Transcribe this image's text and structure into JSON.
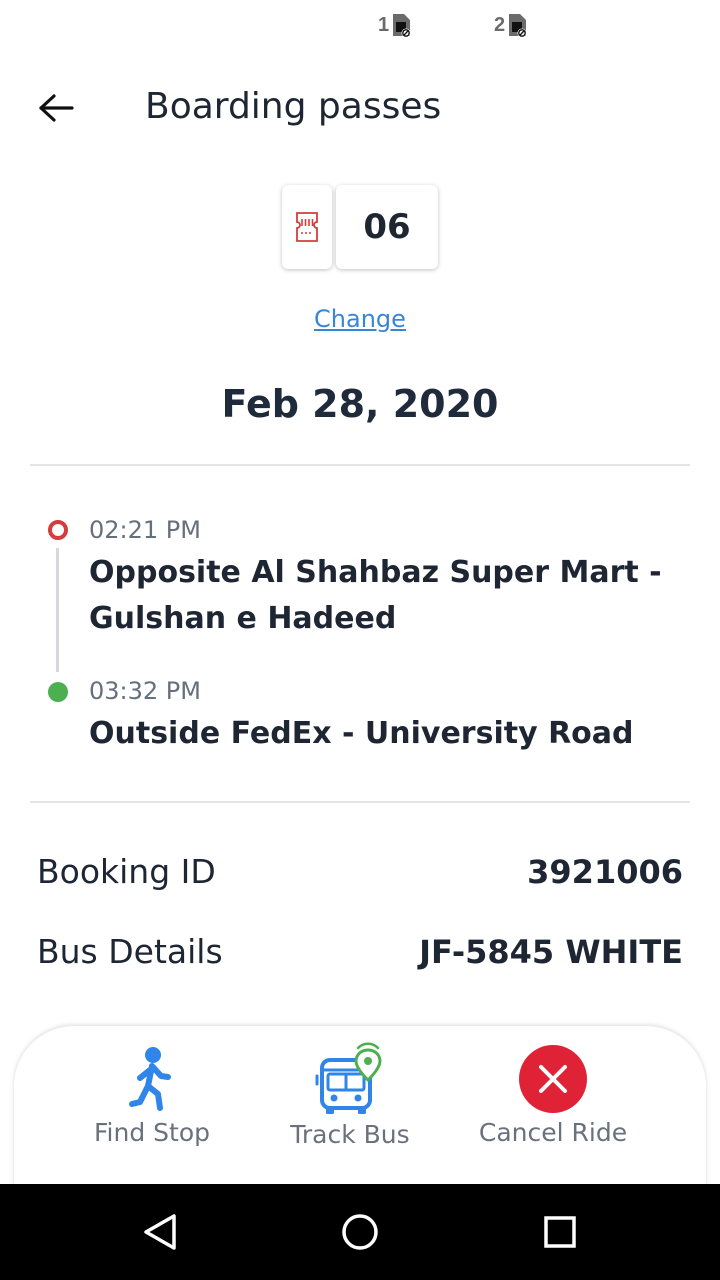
{
  "status_bar": {
    "sim1": "1",
    "sim2": "2"
  },
  "header": {
    "title": "Boarding passes",
    "back_icon": "arrow-left-icon"
  },
  "pass_selector": {
    "icon": "ticket-icon",
    "count": "06",
    "change_label": "Change"
  },
  "trip": {
    "date": "Feb 28, 2020",
    "origin": {
      "time": "02:21 PM",
      "name": "Opposite Al Shahbaz Super Mart - Gulshan e Hadeed"
    },
    "destination": {
      "time": "03:32 PM",
      "name": "Outside FedEx - University Road"
    }
  },
  "booking": {
    "id_label": "Booking ID",
    "id_value": "3921006",
    "bus_label": "Bus Details",
    "bus_value": "JF-5845 WHITE"
  },
  "actions": [
    {
      "label": "Find Stop",
      "icon": "walking-person-icon"
    },
    {
      "label": "Track Bus",
      "icon": "bus-location-icon"
    },
    {
      "label": "Cancel Ride",
      "icon": "cancel-x-icon"
    }
  ],
  "nav_bar": {
    "back": "nav-back-icon",
    "home": "nav-home-icon",
    "recent": "nav-recent-icon"
  },
  "colors": {
    "origin_marker": "#d43d3d",
    "destination_marker": "#4caf50",
    "link": "#3a86d6",
    "cancel_button": "#e02236",
    "action_icon_blue": "#2f86e8"
  }
}
